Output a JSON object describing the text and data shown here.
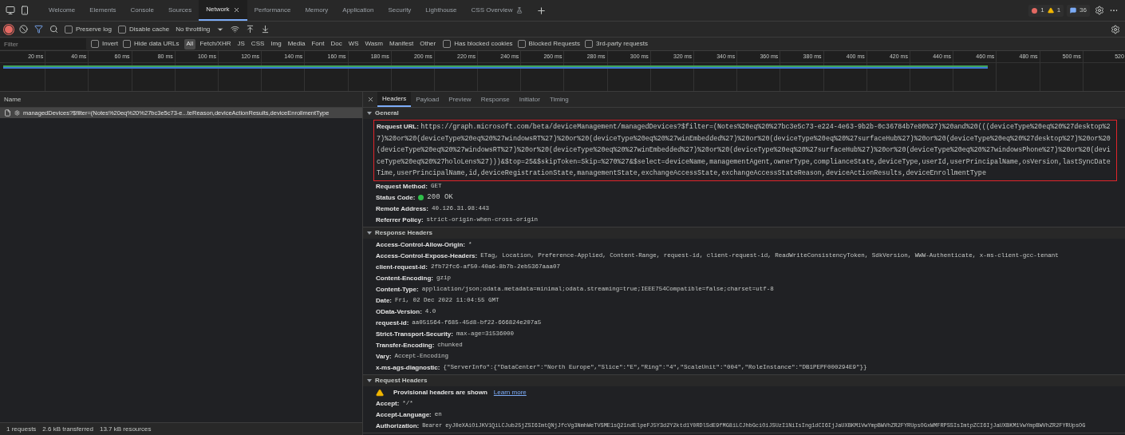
{
  "tabs": [
    {
      "label": "Welcome",
      "selected": false,
      "kind": "plain"
    },
    {
      "label": "Elements",
      "selected": false,
      "kind": "plain"
    },
    {
      "label": "Console",
      "selected": false,
      "kind": "plain"
    },
    {
      "label": "Sources",
      "selected": false,
      "kind": "plain"
    },
    {
      "label": "Network",
      "selected": true,
      "kind": "closable"
    },
    {
      "label": "Performance",
      "selected": false,
      "kind": "plain"
    },
    {
      "label": "Memory",
      "selected": false,
      "kind": "plain"
    },
    {
      "label": "Application",
      "selected": false,
      "kind": "plain"
    },
    {
      "label": "Security",
      "selected": false,
      "kind": "plain"
    },
    {
      "label": "Lighthouse",
      "selected": false,
      "kind": "plain"
    },
    {
      "label": "CSS Overview",
      "selected": false,
      "kind": "experimental"
    }
  ],
  "counters": {
    "errors": "1",
    "warnings": "1",
    "messages": "36"
  },
  "toolbar": {
    "recording": true,
    "preserve_log": {
      "label": "Preserve log",
      "checked": false
    },
    "disable_cache": {
      "label": "Disable cache",
      "checked": false
    },
    "throttling": "No throttling"
  },
  "filter_bar": {
    "placeholder": "Filter",
    "options_before": [
      {
        "label": "Invert",
        "checked": false
      },
      {
        "label": "Hide data URLs",
        "checked": false
      }
    ],
    "types": [
      {
        "label": "All",
        "selected": true
      },
      {
        "label": "Fetch/XHR",
        "selected": false
      },
      {
        "label": "JS",
        "selected": false
      },
      {
        "label": "CSS",
        "selected": false
      },
      {
        "label": "Img",
        "selected": false
      },
      {
        "label": "Media",
        "selected": false
      },
      {
        "label": "Font",
        "selected": false
      },
      {
        "label": "Doc",
        "selected": false
      },
      {
        "label": "WS",
        "selected": false
      },
      {
        "label": "Wasm",
        "selected": false
      },
      {
        "label": "Manifest",
        "selected": false
      },
      {
        "label": "Other",
        "selected": false
      }
    ],
    "options_after": [
      {
        "label": "Has blocked cookies",
        "checked": false
      },
      {
        "label": "Blocked Requests",
        "checked": false
      },
      {
        "label": "3rd-party requests",
        "checked": false
      }
    ]
  },
  "timeline": {
    "ticks": [
      "20 ms",
      "40 ms",
      "60 ms",
      "80 ms",
      "100 ms",
      "120 ms",
      "140 ms",
      "160 ms",
      "180 ms",
      "200 ms",
      "220 ms",
      "240 ms",
      "260 ms",
      "280 ms",
      "300 ms",
      "320 ms",
      "340 ms",
      "360 ms",
      "380 ms",
      "400 ms",
      "420 ms",
      "440 ms",
      "460 ms",
      "480 ms",
      "500 ms",
      "520"
    ]
  },
  "requests": {
    "column": "Name",
    "rows": [
      {
        "name": "managedDevices?$filter=(Notes%20eq%20%27bc3e5c73-e...teReason,deviceActionResults,deviceEnrollmentType",
        "selected": true
      }
    ]
  },
  "details": {
    "tabs": [
      {
        "label": "Headers",
        "selected": true
      },
      {
        "label": "Payload",
        "selected": false
      },
      {
        "label": "Preview",
        "selected": false
      },
      {
        "label": "Response",
        "selected": false
      },
      {
        "label": "Initiator",
        "selected": false
      },
      {
        "label": "Timing",
        "selected": false
      }
    ],
    "sections": [
      {
        "title": "General",
        "expanded": true,
        "rows": [
          {
            "kind": "highlighted",
            "name": "Request URL:",
            "value": "https://graph.microsoft.com/beta/deviceManagement/managedDevices?$filter=(Notes%20eq%20%27bc3e5c73-e224-4e63-9b2b-0c36784b7e80%27)%20and%20(((deviceType%20eq%20%27desktop%27)%20or%20(deviceType%20eq%20%27windowsRT%27)%20or%20(deviceType%20eq%20%27winEmbedded%27)%20or%20(deviceType%20eq%20%27surfaceHub%27)%20or%20(deviceType%20eq%20%27desktop%27)%20or%20(deviceType%20eq%20%27windowsRT%27)%20or%20(deviceType%20eq%20%27winEmbedded%27)%20or%20(deviceType%20eq%20%27surfaceHub%27)%20or%20(deviceType%20eq%20%27windowsPhone%27)%20or%20(deviceType%20eq%20%27holoLens%27)))&$top=25&$skipToken=Skip=%270%27&$select=deviceName,managementAgent,ownerType,complianceState,deviceType,userId,userPrincipalName,osVersion,lastSyncDateTime,userPrincipalName,id,deviceRegistrationState,managementState,exchangeAccessState,exchangeAccessStateReason,deviceActionResults,deviceEnrollmentType"
          },
          {
            "kind": "plain",
            "name": "Request Method:",
            "value": "GET"
          },
          {
            "kind": "status",
            "name": "Status Code:",
            "value": "200 OK",
            "color": "#2fbf4a"
          },
          {
            "kind": "plain",
            "name": "Remote Address:",
            "value": "40.126.31.98:443"
          },
          {
            "kind": "plain",
            "name": "Referrer Policy:",
            "value": "strict-origin-when-cross-origin"
          }
        ]
      },
      {
        "title": "Response Headers",
        "expanded": true,
        "rows": [
          {
            "kind": "plain",
            "name": "Access-Control-Allow-Origin:",
            "value": "*"
          },
          {
            "kind": "plain",
            "name": "Access-Control-Expose-Headers:",
            "value": "ETag, Location, Preference-Applied, Content-Range, request-id, client-request-id, ReadWriteConsistencyToken, SdkVersion, WWW-Authenticate, x-ms-client-gcc-tenant"
          },
          {
            "kind": "plain",
            "name": "client-request-id:",
            "value": "2fb72fc6-af50-40a6-8b7b-2eb5367aaa07"
          },
          {
            "kind": "plain",
            "name": "Content-Encoding:",
            "value": "gzip"
          },
          {
            "kind": "plain",
            "name": "Content-Type:",
            "value": "application/json;odata.metadata=minimal;odata.streaming=true;IEEE754Compatible=false;charset=utf-8"
          },
          {
            "kind": "plain",
            "name": "Date:",
            "value": "Fri, 02 Dec 2022 11:04:55 GMT"
          },
          {
            "kind": "plain",
            "name": "OData-Version:",
            "value": "4.0"
          },
          {
            "kind": "plain",
            "name": "request-id:",
            "value": "aa051564-f685-45d8-bf22-666824e207a5"
          },
          {
            "kind": "plain",
            "name": "Strict-Transport-Security:",
            "value": "max-age=31536000"
          },
          {
            "kind": "plain",
            "name": "Transfer-Encoding:",
            "value": "chunked"
          },
          {
            "kind": "plain",
            "name": "Vary:",
            "value": "Accept-Encoding"
          },
          {
            "kind": "plain",
            "name": "x-ms-ags-diagnostic:",
            "value": "{\"ServerInfo\":{\"DataCenter\":\"North Europe\",\"Slice\":\"E\",\"Ring\":\"4\",\"ScaleUnit\":\"004\",\"RoleInstance\":\"DB1PEPF000294E9\"}}"
          }
        ]
      },
      {
        "title": "Request Headers",
        "expanded": true,
        "rows": [
          {
            "kind": "warning",
            "name": "Provisional headers are shown",
            "value": "Learn more"
          },
          {
            "kind": "plain",
            "name": "Accept:",
            "value": "*/*"
          },
          {
            "kind": "plain",
            "name": "Accept-Language:",
            "value": "en"
          },
          {
            "kind": "long",
            "name": "Authorization:",
            "value": "Bearer eyJ0eXAiOiJKV1QiLCJub25jZSI6ImtQNjJfcVg3NmhWeTVSME1sQ21ndElpeFJ5Y3d2Y2ktd1Y0RDlSdE9fMG8iLCJhbGciOiJSUzI1NiIsIng1dCI6IjJaUXBKM1VwYmpBWVhZR2FYRUpsOGxWMFRPSSIsImtpZCI6IjJaUXBKM1VwYmpBWVhZR2FYRUpsOG"
          }
        ]
      }
    ]
  },
  "status_bar": [
    "1 requests",
    "2.6 kB transferred",
    "13.7 kB resources"
  ]
}
